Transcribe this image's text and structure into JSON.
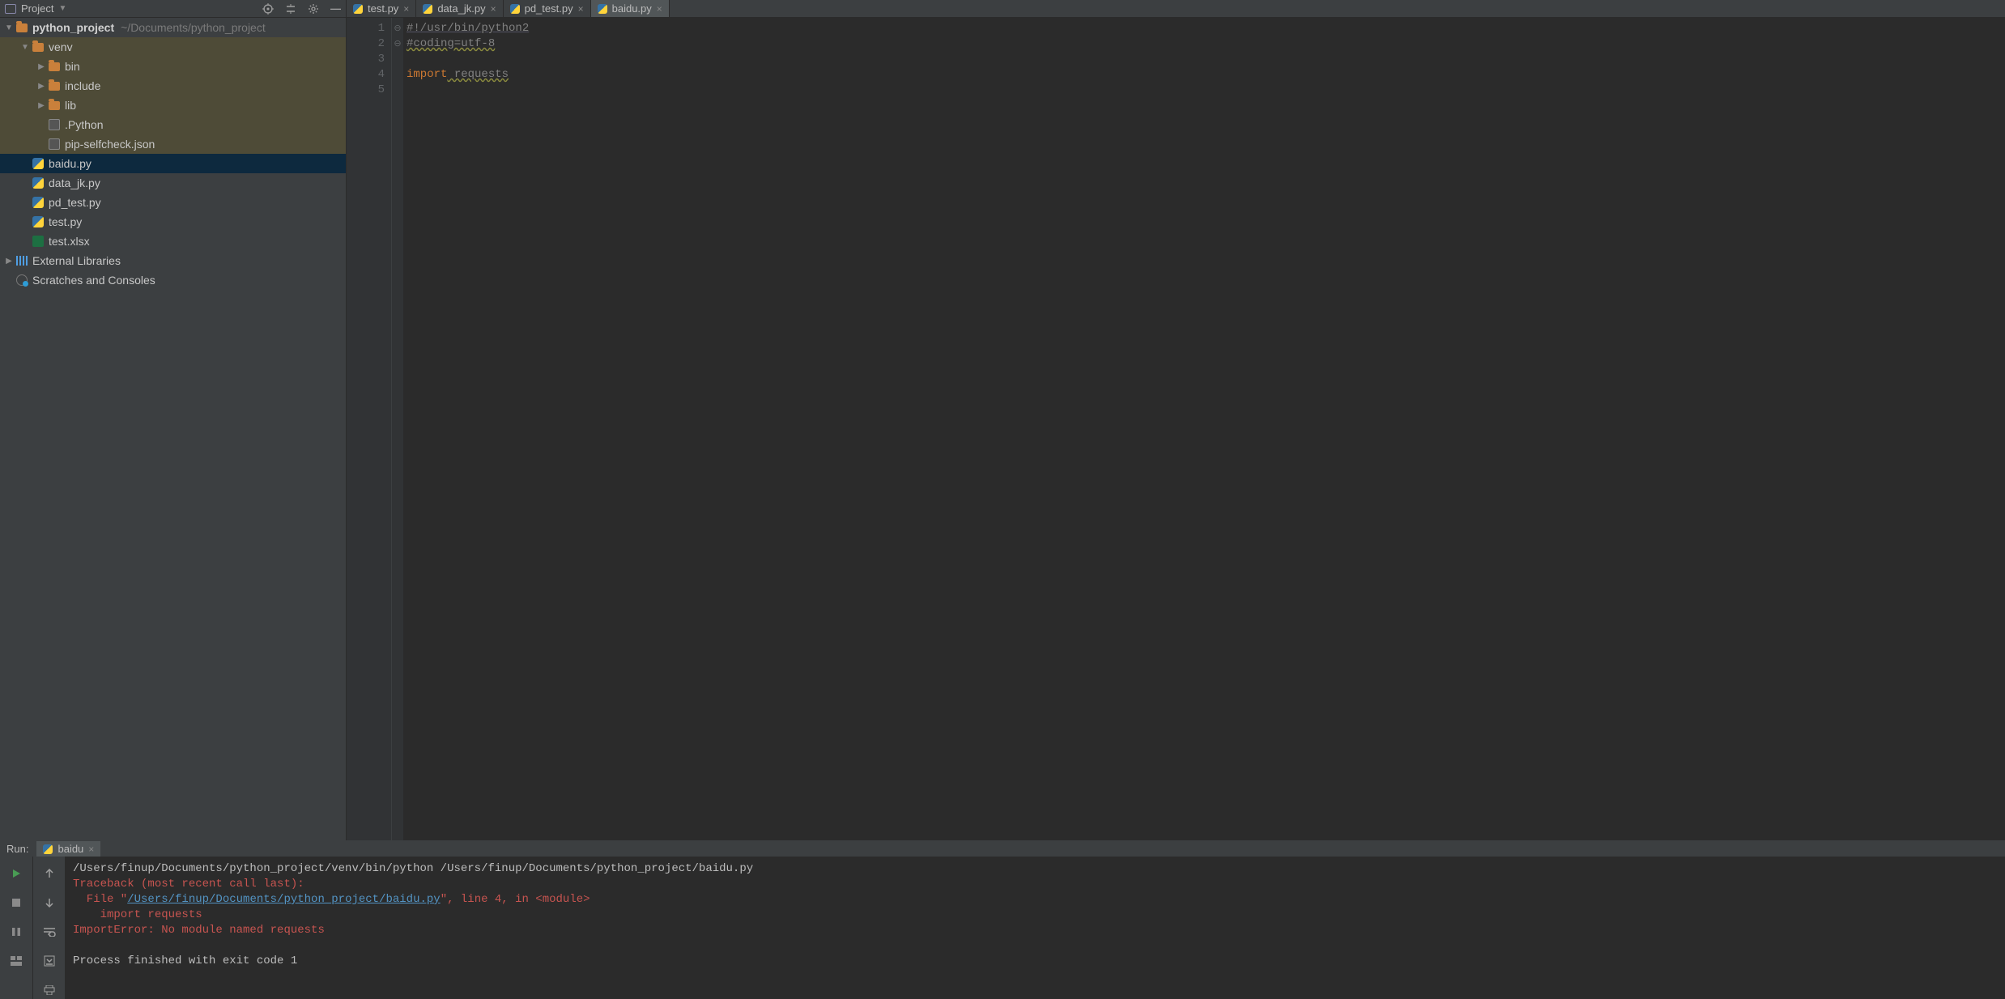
{
  "project_panel": {
    "title": "Project",
    "root": {
      "label": "python_project",
      "path": "~/Documents/python_project"
    },
    "venv": {
      "label": "venv",
      "children": {
        "bin": "bin",
        "include": "include",
        "lib": "lib",
        "dot_python": ".Python",
        "pip_selfcheck": "pip-selfcheck.json"
      }
    },
    "files": {
      "baidu": "baidu.py",
      "data_jk": "data_jk.py",
      "pd_test": "pd_test.py",
      "test": "test.py",
      "test_xlsx": "test.xlsx"
    },
    "external_libraries": "External Libraries",
    "scratches": "Scratches and Consoles"
  },
  "tabs": [
    {
      "label": "test.py",
      "active": false
    },
    {
      "label": "data_jk.py",
      "active": false
    },
    {
      "label": "pd_test.py",
      "active": false
    },
    {
      "label": "baidu.py",
      "active": true
    }
  ],
  "editor": {
    "line_numbers": [
      "1",
      "2",
      "3",
      "4",
      "5"
    ],
    "code": {
      "l1": "#!/usr/bin/python2",
      "l2": "#coding=utf-8",
      "l3": "",
      "l4_kw": "import",
      "l4_mod": " requests",
      "l5": ""
    }
  },
  "run": {
    "label": "Run:",
    "config_name": "baidu",
    "output": {
      "cmd": "/Users/finup/Documents/python_project/venv/bin/python /Users/finup/Documents/python_project/baidu.py",
      "tb_header": "Traceback (most recent call last):",
      "file_prefix": "  File \"",
      "file_link": "/Users/finup/Documents/python_project/baidu.py",
      "file_suffix": "\", line 4, in <module>",
      "import_line": "    import requests",
      "err": "ImportError: No module named requests",
      "blank": "",
      "exit": "Process finished with exit code 1"
    }
  }
}
